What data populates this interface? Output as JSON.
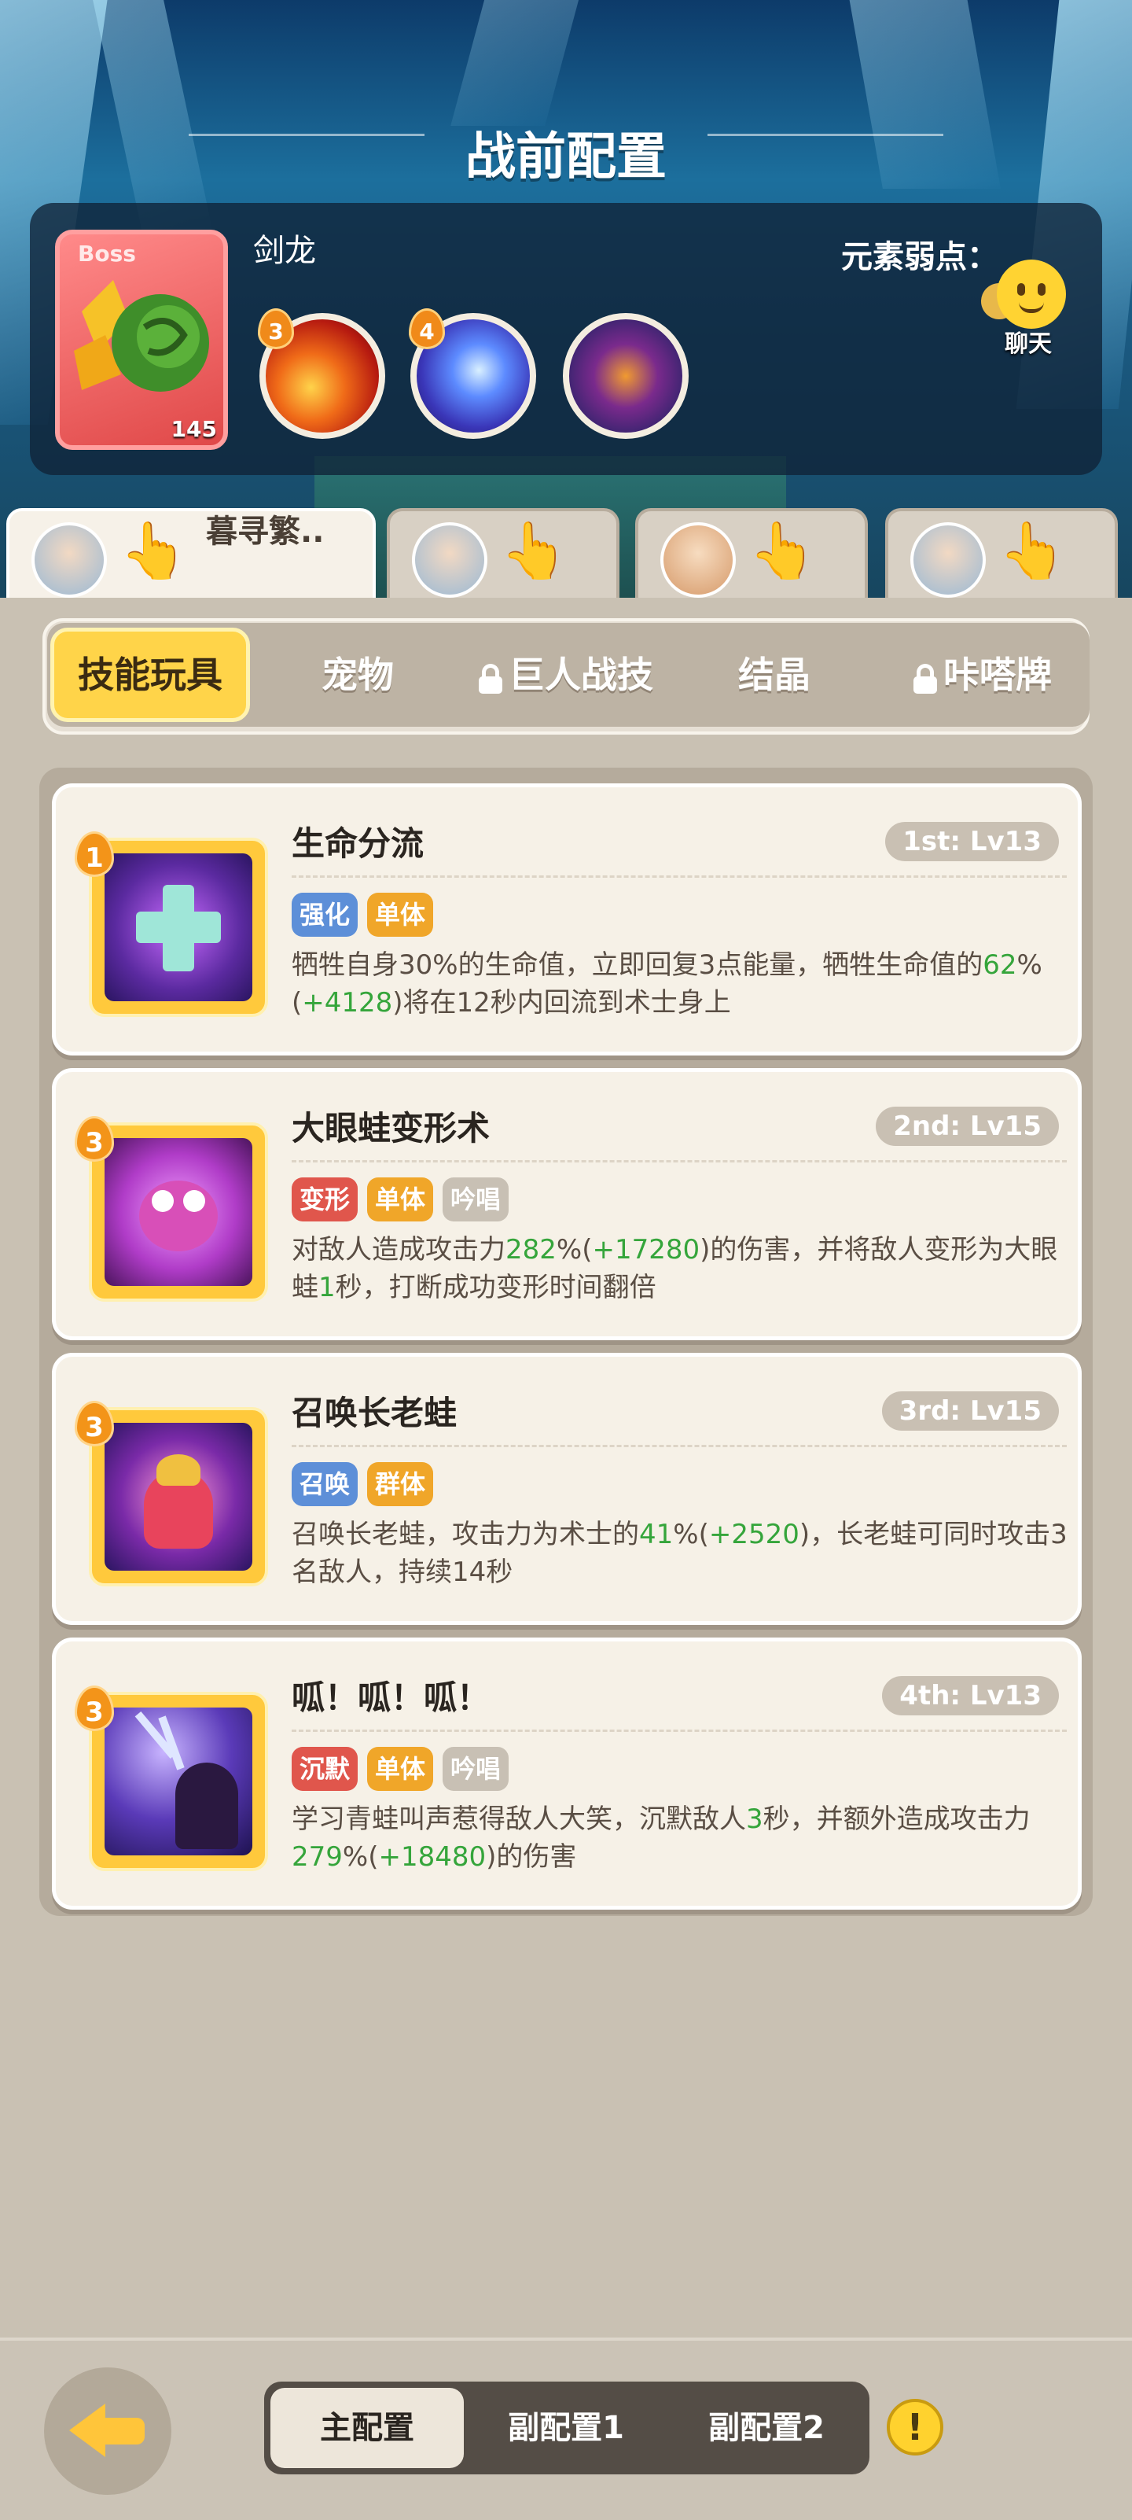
{
  "header": {
    "title": "战前配置"
  },
  "boss": {
    "tag": "Boss",
    "level": "145",
    "name": "剑龙",
    "weakness_label": "元素弱点：",
    "skills": [
      {
        "badge": "3",
        "icon": "fire-swirl-icon",
        "color": "#e23a1c"
      },
      {
        "badge": "4",
        "icon": "water-swirl-icon",
        "color": "#4a5dd8"
      },
      {
        "badge": "",
        "icon": "demon-face-icon",
        "color": "#3b2470"
      }
    ]
  },
  "chat": {
    "label": "聊天",
    "icon": "chat-icon"
  },
  "heroes": [
    {
      "name": "暮寻繁..",
      "active": true
    },
    {
      "name": "",
      "active": false
    },
    {
      "name": "",
      "active": false
    },
    {
      "name": "",
      "active": false
    }
  ],
  "categories": {
    "skill_toys": "技能玩具",
    "pets": "宠物",
    "giant_skill": "巨人战技",
    "crystal": "结晶",
    "card": "咔嗒牌"
  },
  "skills": [
    {
      "badge": "1",
      "title": "生命分流",
      "rank": "1st: Lv13",
      "tags": [
        "强化",
        "单体"
      ],
      "desc_parts": [
        "牺牲自身30%的生命值，立即回复3点能量，牺牲生命值的",
        "62",
        "%(",
        "+4128",
        ")将在12秒内回流到术士身上"
      ]
    },
    {
      "badge": "3",
      "title": "大眼蛙变形术",
      "rank": "2nd: Lv15",
      "tags": [
        "变形",
        "单体",
        "吟唱"
      ],
      "desc_parts": [
        "对敌人造成攻击力",
        "282",
        "%(",
        "+17280",
        ")的伤害，并将敌人变形为大眼蛙",
        "1",
        "秒，打断成功变形时间翻倍"
      ]
    },
    {
      "badge": "3",
      "title": "召唤长老蛙",
      "rank": "3rd: Lv15",
      "tags": [
        "召唤",
        "群体"
      ],
      "desc_parts": [
        "召唤长老蛙，攻击力为术士的",
        "41",
        "%(",
        "+2520",
        ")，长老蛙可同时攻击3名敌人，持续14秒"
      ]
    },
    {
      "badge": "3",
      "title": "呱！呱！呱！",
      "rank": "4th: Lv13",
      "tags": [
        "沉默",
        "单体",
        "吟唱"
      ],
      "desc_parts": [
        "学习青蛙叫声惹得敌人大笑，沉默敌人",
        "3",
        "秒，并额外造成攻击力",
        "279",
        "%(",
        "+18480",
        ")的伤害"
      ]
    }
  ],
  "bottom": {
    "main_config": "主配置",
    "sub_config_1": "副配置1",
    "sub_config_2": "副配置2",
    "warn": "!"
  }
}
